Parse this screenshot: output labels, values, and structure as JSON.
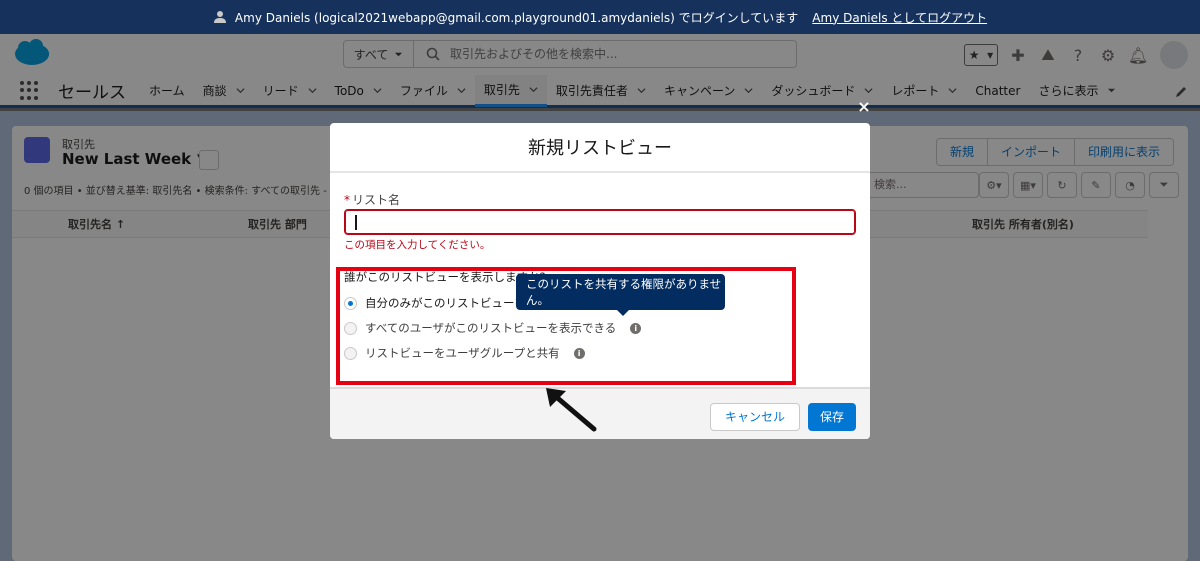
{
  "banner": {
    "login_text": "Amy Daniels (logical2021webapp@gmail.com.playground01.amydaniels) でログインしています",
    "logout_link": "Amy Daniels としてログアウト"
  },
  "header": {
    "scope_label": "すべて",
    "search_placeholder": "取引先およびその他を検索中..."
  },
  "nav": {
    "app_name": "セールス",
    "items": [
      {
        "label": "ホーム",
        "chevron": false
      },
      {
        "label": "商談",
        "chevron": true
      },
      {
        "label": "リード",
        "chevron": true
      },
      {
        "label": "ToDo",
        "chevron": true
      },
      {
        "label": "ファイル",
        "chevron": true
      },
      {
        "label": "取引先",
        "chevron": true,
        "active": true
      },
      {
        "label": "取引先責任者",
        "chevron": true
      },
      {
        "label": "キャンペーン",
        "chevron": true
      },
      {
        "label": "ダッシュボード",
        "chevron": true
      },
      {
        "label": "レポート",
        "chevron": true
      },
      {
        "label": "Chatter",
        "chevron": false
      },
      {
        "label": "さらに表示",
        "chevron": true
      }
    ]
  },
  "list": {
    "object_label": "取引先",
    "view_name": "New Last Week",
    "info_line": "0 個の項目 • 並び替え基準: 取引先名 • 検索条件: すべての取引先 - 作",
    "buttons": {
      "new": "新規",
      "import": "インポート",
      "print": "印刷用に表示"
    },
    "search_placeholder": "検索...",
    "columns": [
      "取引先名 ↑",
      "取引先 部門",
      "取引先 所有者(別名)"
    ]
  },
  "modal": {
    "title": "新規リストビュー",
    "field_label": "リスト名",
    "field_required_mark": "*",
    "field_error": "この項目を入力してください。",
    "share_title": "誰がこのリストビューを表示しますか?",
    "options": [
      {
        "label": "自分のみがこのリストビューを表示できる",
        "checked": true,
        "info": false
      },
      {
        "label": "すべてのユーザがこのリストビューを表示できる",
        "checked": false,
        "info": true
      },
      {
        "label": "リストビューをユーザグループと共有",
        "checked": false,
        "info": true
      }
    ],
    "tooltip": "このリストを共有する権限がありません。",
    "cancel_label": "キャンセル",
    "save_label": "保存",
    "close_symbol": "×"
  },
  "colors": {
    "banner": "#16325c",
    "brand_blue": "#0176d3",
    "error_red": "#ba0517",
    "annotation_red": "#e60012",
    "tooltip_bg": "#032d60"
  }
}
